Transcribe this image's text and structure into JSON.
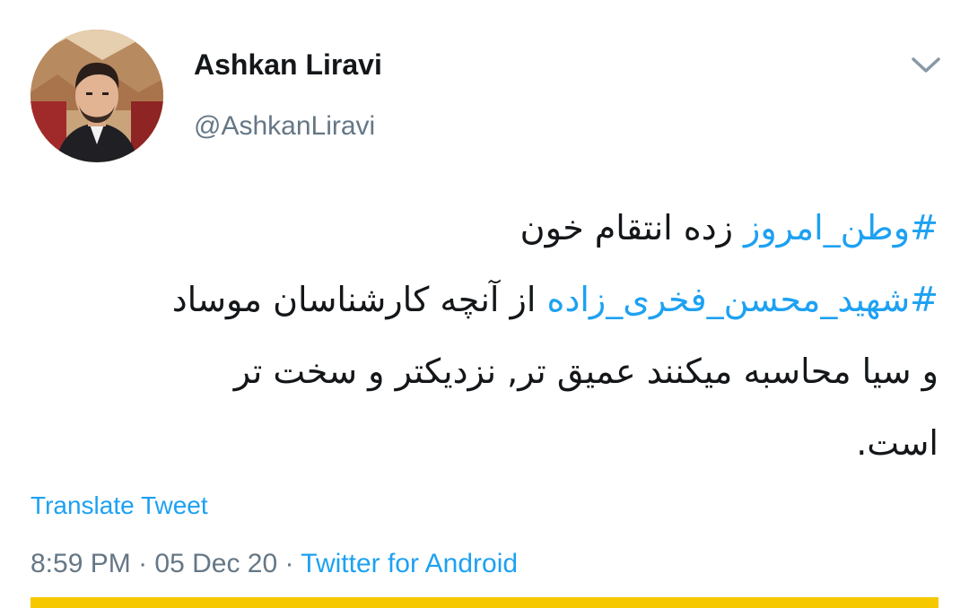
{
  "author": {
    "display_name": "Ashkan Liravi",
    "handle": "@AshkanLiravi",
    "avatar_icon": "profile-photo"
  },
  "menu": {
    "icon": "chevron-down-icon"
  },
  "tweet": {
    "line1": {
      "hashtag": "#وطن_امروز",
      "text": " زده انتقام خون"
    },
    "line2": {
      "hashtag": "#شهید_محسن_فخری_زاده",
      "text": " از آنچه کارشناسان موساد"
    },
    "line3": "و سیا محاسبه میکنند عمیق تر, نزدیکتر و سخت تر",
    "line4": "است."
  },
  "translate_label": "Translate Tweet",
  "meta": {
    "time": "8:59 PM",
    "separator1": " · ",
    "date": "05 Dec 20",
    "separator2": " · ",
    "source": "Twitter for Android"
  },
  "colors": {
    "link": "#1da1f2",
    "secondary_text": "#657786",
    "primary_text": "#14171a",
    "accent_bar": "#f5c800"
  }
}
